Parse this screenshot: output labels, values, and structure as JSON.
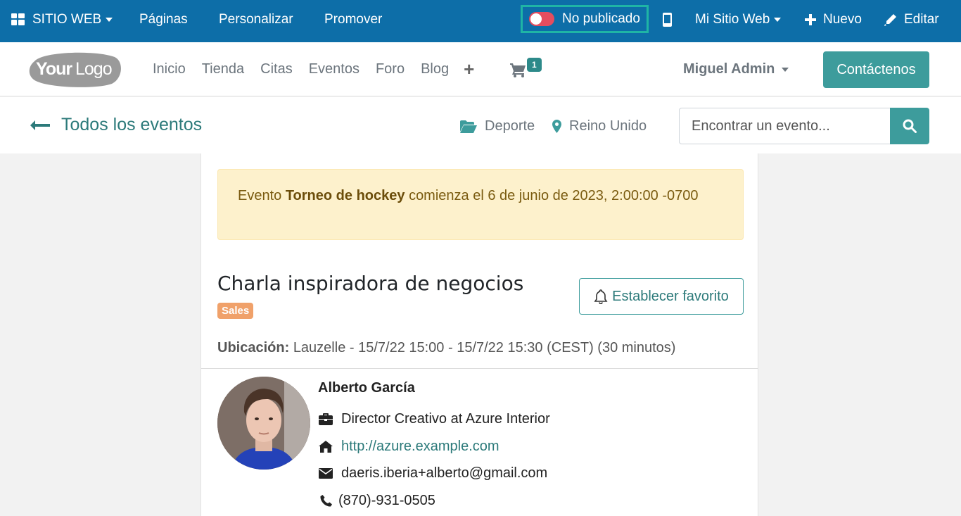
{
  "adminbar": {
    "site_menu": "SITIO WEB",
    "pages": "Páginas",
    "customize": "Personalizar",
    "promote": "Promover",
    "publish_status": "No publicado",
    "my_site": "Mi Sitio Web",
    "new": "Nuevo",
    "edit": "Editar"
  },
  "header": {
    "logo_text": "YourLogo",
    "nav": [
      "Inicio",
      "Tienda",
      "Citas",
      "Eventos",
      "Foro",
      "Blog"
    ],
    "cart_count": "1",
    "user": "Miguel Admin",
    "contact": "Contáctenos"
  },
  "subbar": {
    "back": "Todos los eventos",
    "category": "Deporte",
    "country": "Reino Unido",
    "search_placeholder": "Encontrar un evento..."
  },
  "alert": {
    "prefix": "Evento",
    "event_name": "Torneo de hockey",
    "suffix": "comienza el 6 de junio de 2023, 2:00:00 -0700"
  },
  "event": {
    "title": "Charla inspiradora de negocios",
    "tag": "Sales",
    "favorite": "Establecer favorito",
    "location_label": "Ubicación:",
    "location_value": "Lauzelle - 15/7/22 15:00 - 15/7/22 15:30 (CEST) (30 minutos)"
  },
  "speaker": {
    "name": "Alberto García",
    "role": "Director Creativo at Azure Interior",
    "website": "http://azure.example.com",
    "email": "daeris.iberia+alberto@gmail.com",
    "phone": "(870)-931-0505"
  },
  "colors": {
    "admin_bar": "#0d6ea8",
    "accent": "#3d9c9c",
    "toggle_off": "#e44d5f",
    "alert_bg": "#fdf1cc",
    "tag": "#f0a16a"
  }
}
